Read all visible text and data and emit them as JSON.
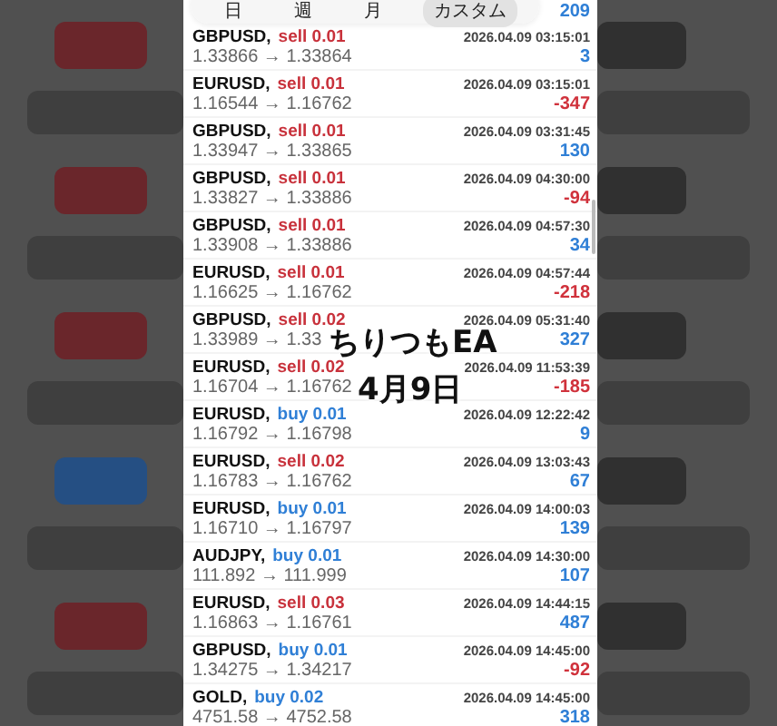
{
  "tabs": [
    {
      "label": "日",
      "selected": false
    },
    {
      "label": "週",
      "selected": false
    },
    {
      "label": "月",
      "selected": false
    },
    {
      "label": "カスタム",
      "selected": true
    }
  ],
  "partial_row": {
    "profit": "209"
  },
  "trades": [
    {
      "symbol": "GBPUSD,",
      "side": "sell",
      "volume": "0.01",
      "time": "2026.04.09 03:15:01",
      "prices": "1.33866 → 1.33864",
      "profit": "3",
      "loss": false
    },
    {
      "symbol": "EURUSD,",
      "side": "sell",
      "volume": "0.01",
      "time": "2026.04.09 03:15:01",
      "prices": "1.16544 → 1.16762",
      "profit": "-347",
      "loss": true
    },
    {
      "symbol": "GBPUSD,",
      "side": "sell",
      "volume": "0.01",
      "time": "2026.04.09 03:31:45",
      "prices": "1.33947 → 1.33865",
      "profit": "130",
      "loss": false
    },
    {
      "symbol": "GBPUSD,",
      "side": "sell",
      "volume": "0.01",
      "time": "2026.04.09 04:30:00",
      "prices": "1.33827 → 1.33886",
      "profit": "-94",
      "loss": true
    },
    {
      "symbol": "GBPUSD,",
      "side": "sell",
      "volume": "0.01",
      "time": "2026.04.09 04:57:30",
      "prices": "1.33908 → 1.33886",
      "profit": "34",
      "loss": false
    },
    {
      "symbol": "EURUSD,",
      "side": "sell",
      "volume": "0.01",
      "time": "2026.04.09 04:57:44",
      "prices": "1.16625 → 1.16762",
      "profit": "-218",
      "loss": true
    },
    {
      "symbol": "GBPUSD,",
      "side": "sell",
      "volume": "0.02",
      "time": "2026.04.09 05:31:40",
      "prices": "1.33989 → 1.33",
      "profit": "327",
      "loss": false
    },
    {
      "symbol": "EURUSD,",
      "side": "sell",
      "volume": "0.02",
      "time": "2026.04.09 11:53:39",
      "prices": "1.16704 → 1.16762",
      "profit": "-185",
      "loss": true
    },
    {
      "symbol": "EURUSD,",
      "side": "buy",
      "volume": "0.01",
      "time": "2026.04.09 12:22:42",
      "prices": "1.16792 → 1.16798",
      "profit": "9",
      "loss": false
    },
    {
      "symbol": "EURUSD,",
      "side": "sell",
      "volume": "0.02",
      "time": "2026.04.09 13:03:43",
      "prices": "1.16783 → 1.16762",
      "profit": "67",
      "loss": false
    },
    {
      "symbol": "EURUSD,",
      "side": "buy",
      "volume": "0.01",
      "time": "2026.04.09 14:00:03",
      "prices": "1.16710 → 1.16797",
      "profit": "139",
      "loss": false
    },
    {
      "symbol": "AUDJPY,",
      "side": "buy",
      "volume": "0.01",
      "time": "2026.04.09 14:30:00",
      "prices": "111.892 → 111.999",
      "profit": "107",
      "loss": false
    },
    {
      "symbol": "EURUSD,",
      "side": "sell",
      "volume": "0.03",
      "time": "2026.04.09 14:44:15",
      "prices": "1.16863 → 1.16761",
      "profit": "487",
      "loss": false
    },
    {
      "symbol": "GBPUSD,",
      "side": "buy",
      "volume": "0.01",
      "time": "2026.04.09 14:45:00",
      "prices": "1.34275 → 1.34217",
      "profit": "-92",
      "loss": true
    },
    {
      "symbol": "GOLD,",
      "side": "buy",
      "volume": "0.02",
      "time": "2026.04.09 14:45:00",
      "prices": "4751.58 → 4752.58",
      "profit": "318",
      "loss": false
    }
  ],
  "caption": {
    "title": "ちりつもEA",
    "date": "4月9日"
  }
}
